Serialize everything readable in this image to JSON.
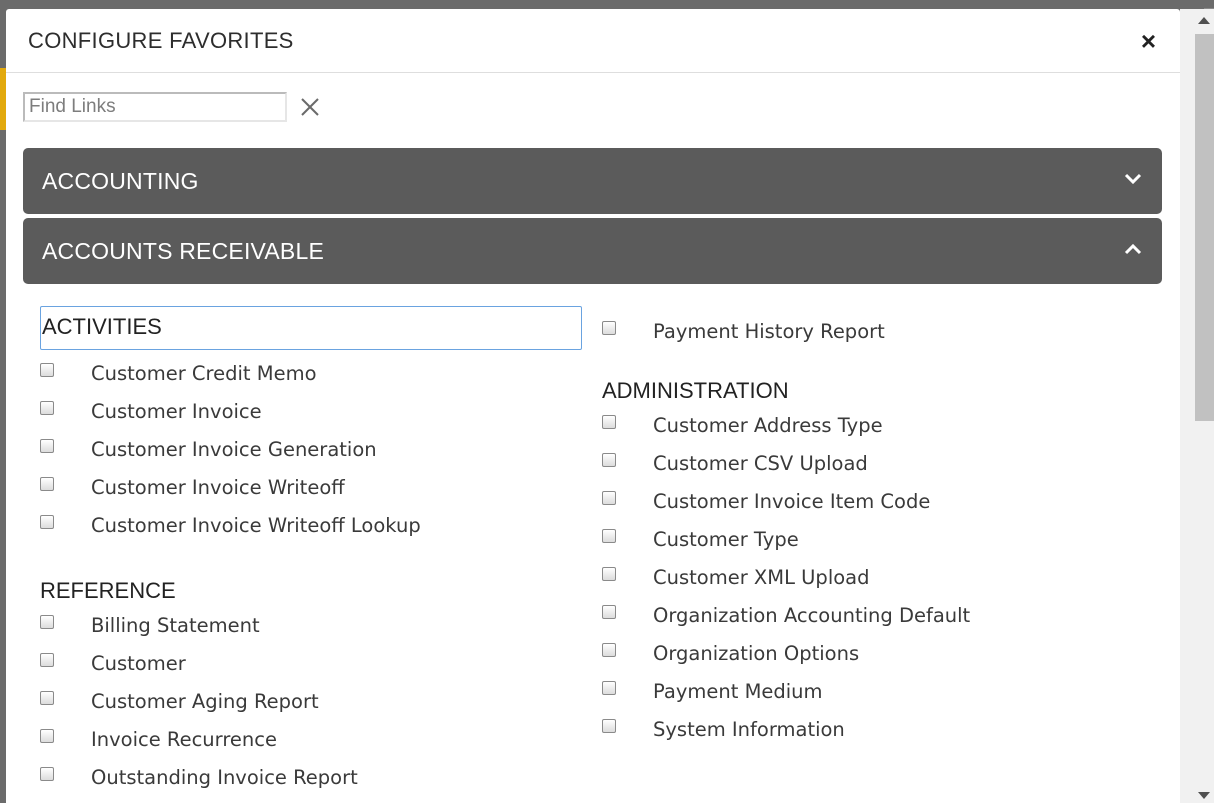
{
  "modal": {
    "title": "CONFIGURE FAVORITES",
    "close_label": "×"
  },
  "search": {
    "placeholder": "Find Links",
    "value": ""
  },
  "accordions": [
    {
      "label": "ACCOUNTING",
      "expanded": false
    },
    {
      "label": "ACCOUNTS RECEIVABLE",
      "expanded": true
    }
  ],
  "sections": {
    "activities": {
      "heading": "ACTIVITIES",
      "items": [
        "Customer Credit Memo",
        "Customer Invoice",
        "Customer Invoice Generation",
        "Customer Invoice Writeoff",
        "Customer Invoice Writeoff Lookup"
      ]
    },
    "reference": {
      "heading": "REFERENCE",
      "items": [
        "Billing Statement",
        "Customer",
        "Customer Aging Report",
        "Invoice Recurrence",
        "Outstanding Invoice Report"
      ]
    },
    "reports_continued": {
      "items": [
        "Payment History Report"
      ]
    },
    "administration": {
      "heading": "ADMINISTRATION",
      "items": [
        "Customer Address Type",
        "Customer CSV Upload",
        "Customer Invoice Item Code",
        "Customer Type",
        "Customer XML Upload",
        "Organization Accounting Default",
        "Organization Options",
        "Payment Medium",
        "System Information"
      ]
    }
  },
  "icons": {
    "close": "close-icon",
    "clear": "clear-search-icon",
    "collapsed": "chevron-down-icon",
    "expanded": "chevron-up-icon"
  }
}
